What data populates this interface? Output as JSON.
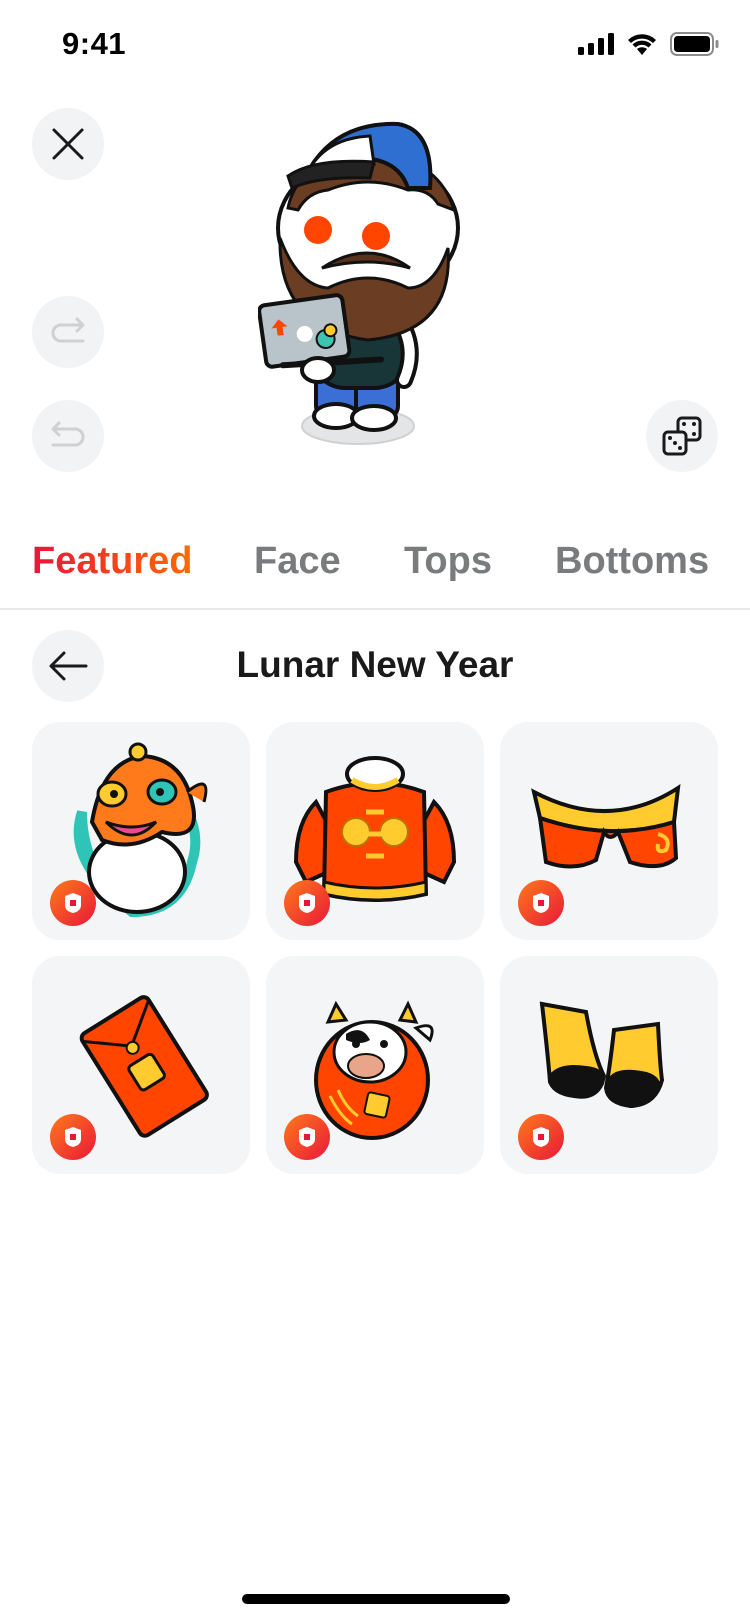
{
  "status_bar": {
    "time": "9:41"
  },
  "tabs": [
    {
      "label": "Featured",
      "active": true
    },
    {
      "label": "Face",
      "active": false
    },
    {
      "label": "Tops",
      "active": false
    },
    {
      "label": "Bottoms",
      "active": false
    }
  ],
  "section": {
    "title": "Lunar New Year"
  },
  "items": [
    {
      "icon": "lion-dance-headwear-icon",
      "badge": "premium-badge-icon"
    },
    {
      "icon": "red-tang-jacket-icon",
      "badge": "premium-badge-icon"
    },
    {
      "icon": "red-pants-icon",
      "badge": "premium-badge-icon"
    },
    {
      "icon": "red-envelope-icon",
      "badge": "premium-badge-icon"
    },
    {
      "icon": "ox-daruma-costume-icon",
      "badge": "premium-badge-icon"
    },
    {
      "icon": "black-yellow-shoes-icon",
      "badge": "premium-badge-icon"
    }
  ],
  "colors": {
    "accent_start": "#e8173a",
    "accent_end": "#ff6a00",
    "tile_bg": "#f4f5f7",
    "button_bg": "#f2f3f5"
  }
}
